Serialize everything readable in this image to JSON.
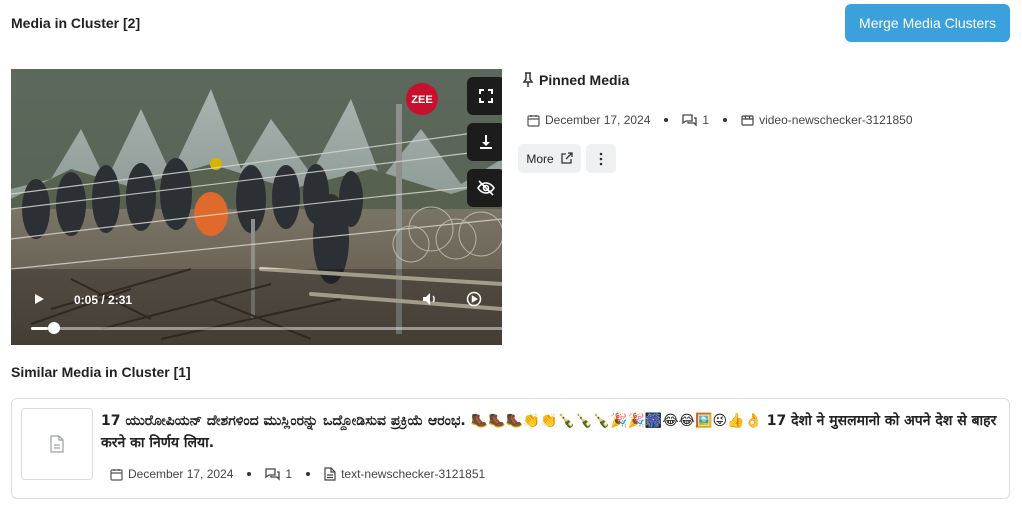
{
  "header": {
    "title": "Media in Cluster [2]",
    "merge_button": "Merge Media Clusters"
  },
  "video": {
    "time": "0:05 / 2:31",
    "progress": 0.035,
    "channel_logo_text": "ZEE"
  },
  "pinned": {
    "title": "Pinned Media",
    "date": "December 17, 2024",
    "comments": "1",
    "id": "video-newschecker-3121850",
    "more_label": "More"
  },
  "similar": {
    "title": "Similar Media in Cluster [1]",
    "items": [
      {
        "text": "17 ಯುರೋಪಿಯನ್ ದೇಶಗಳಿಂದ ಮುಸ್ಲಿಂರನ್ನು ಒದ್ದೋಡಿಸುವ ಪ್ರಕ್ರಿಯೆ ಆರಂಭ. 🥾🥾🥾👏👏🍾🍾🍾🎉🎉🎆😂😂🖼️😜👍👌 17 देशो ने मुसलमानो को अपने देश से बाहर करने का निर्णय लिया.",
        "date": "December 17, 2024",
        "comments": "1",
        "id": "text-newschecker-3121851"
      }
    ]
  },
  "colors": {
    "accent": "#3ba1dc",
    "button_bg": "#eef0f2",
    "border": "#d9dde2"
  }
}
